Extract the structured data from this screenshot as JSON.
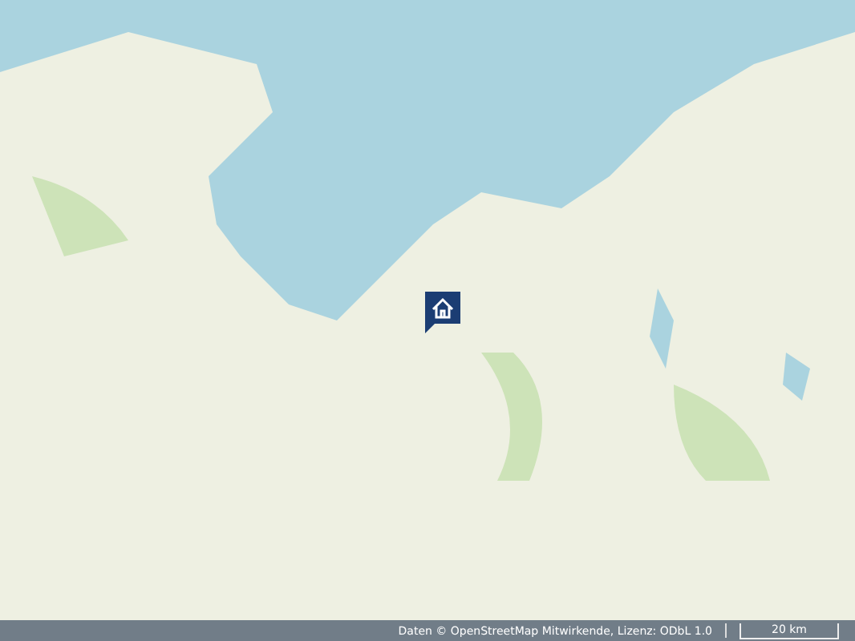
{
  "map": {
    "marker": {
      "kind": "house"
    }
  },
  "footer": {
    "attribution": "Daten © OpenStreetMap Mitwirkende, Lizenz: ODbL 1.0",
    "scale": "20 km"
  }
}
